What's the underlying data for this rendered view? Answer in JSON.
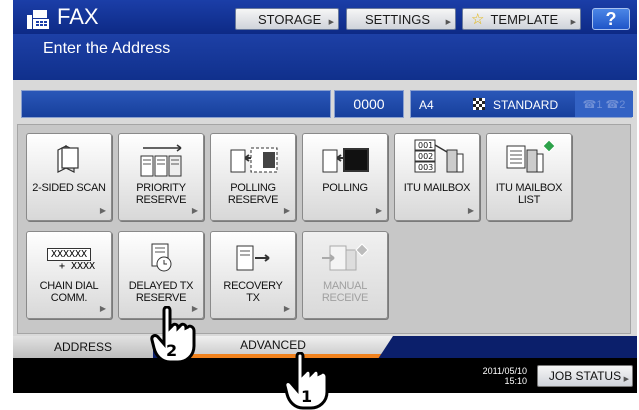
{
  "header": {
    "title": "FAX",
    "subtitle": "Enter the Address",
    "buttons": {
      "storage": "STORAGE",
      "settings": "SETTINGS",
      "template": "TEMPLATE",
      "help": "?"
    }
  },
  "status_bar": {
    "count": "0000",
    "paper_size": "A4",
    "resolution": "STANDARD",
    "lines": "☎1 ☎2"
  },
  "functions": {
    "b1": "2-SIDED SCAN",
    "b2": "PRIORITY\nRESERVE",
    "b3": "POLLING\nRESERVE",
    "b4": "POLLING",
    "b5": "ITU MAILBOX",
    "b6": "ITU MAILBOX\nLIST",
    "b7": "CHAIN DIAL\nCOMM.",
    "b8": "DELAYED TX\nRESERVE",
    "b9": "RECOVERY\nTX",
    "b10": "MANUAL\nRECEIVE",
    "chain_icon_top": "XXXXXX",
    "chain_icon_bottom": "+ XXXX",
    "itu_numbers": [
      "001",
      "002",
      "003"
    ]
  },
  "tabs": {
    "address": "ADDRESS",
    "advanced": "ADVANCED"
  },
  "footer": {
    "date": "2011/05/10",
    "time": "15:10",
    "job_status": "JOB STATUS"
  },
  "callouts": {
    "step1": "1",
    "step2": "2"
  }
}
